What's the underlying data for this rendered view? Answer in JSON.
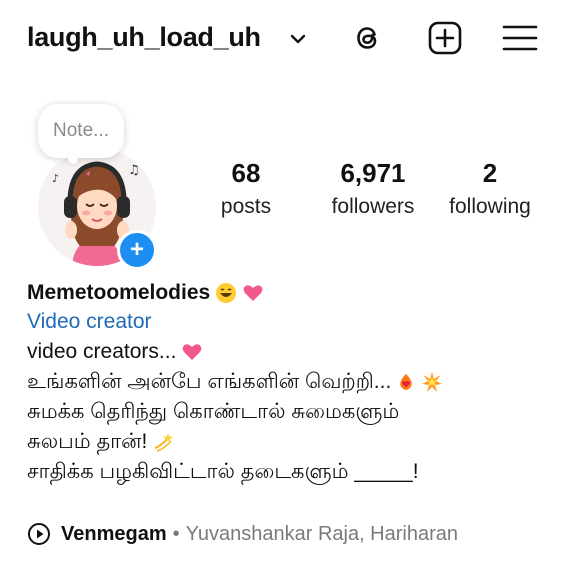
{
  "header": {
    "username": "laugh_uh_load_uh",
    "icons": [
      "chevron-down-icon",
      "threads-icon",
      "new-post-icon",
      "menu-icon"
    ]
  },
  "note": {
    "placeholder": "Note..."
  },
  "stats": [
    {
      "value": "68",
      "label": "posts"
    },
    {
      "value": "6,971",
      "label": "followers"
    },
    {
      "value": "2",
      "label": "following"
    }
  ],
  "profile": {
    "display_name": "Memetoomelodies",
    "category": "Video creator",
    "bio_lines": [
      "video creators...",
      "உங்களின் அன்பே எங்களின் வெற்றி...",
      "சுமக்க தெரிந்து கொண்டால் சுமைகளும்",
      "சுலபம் தான்!",
      "சாதிக்க  பழகிவிட்டால் தடைகளும் _____!"
    ]
  },
  "music": {
    "song": "Venmegam",
    "separator": "•",
    "artists": "Yuvanshankar Raja, Hariharan"
  },
  "colors": {
    "link": "#1f6bb8",
    "badge": "#1d8ff2",
    "muted": "#7a7a7a"
  }
}
